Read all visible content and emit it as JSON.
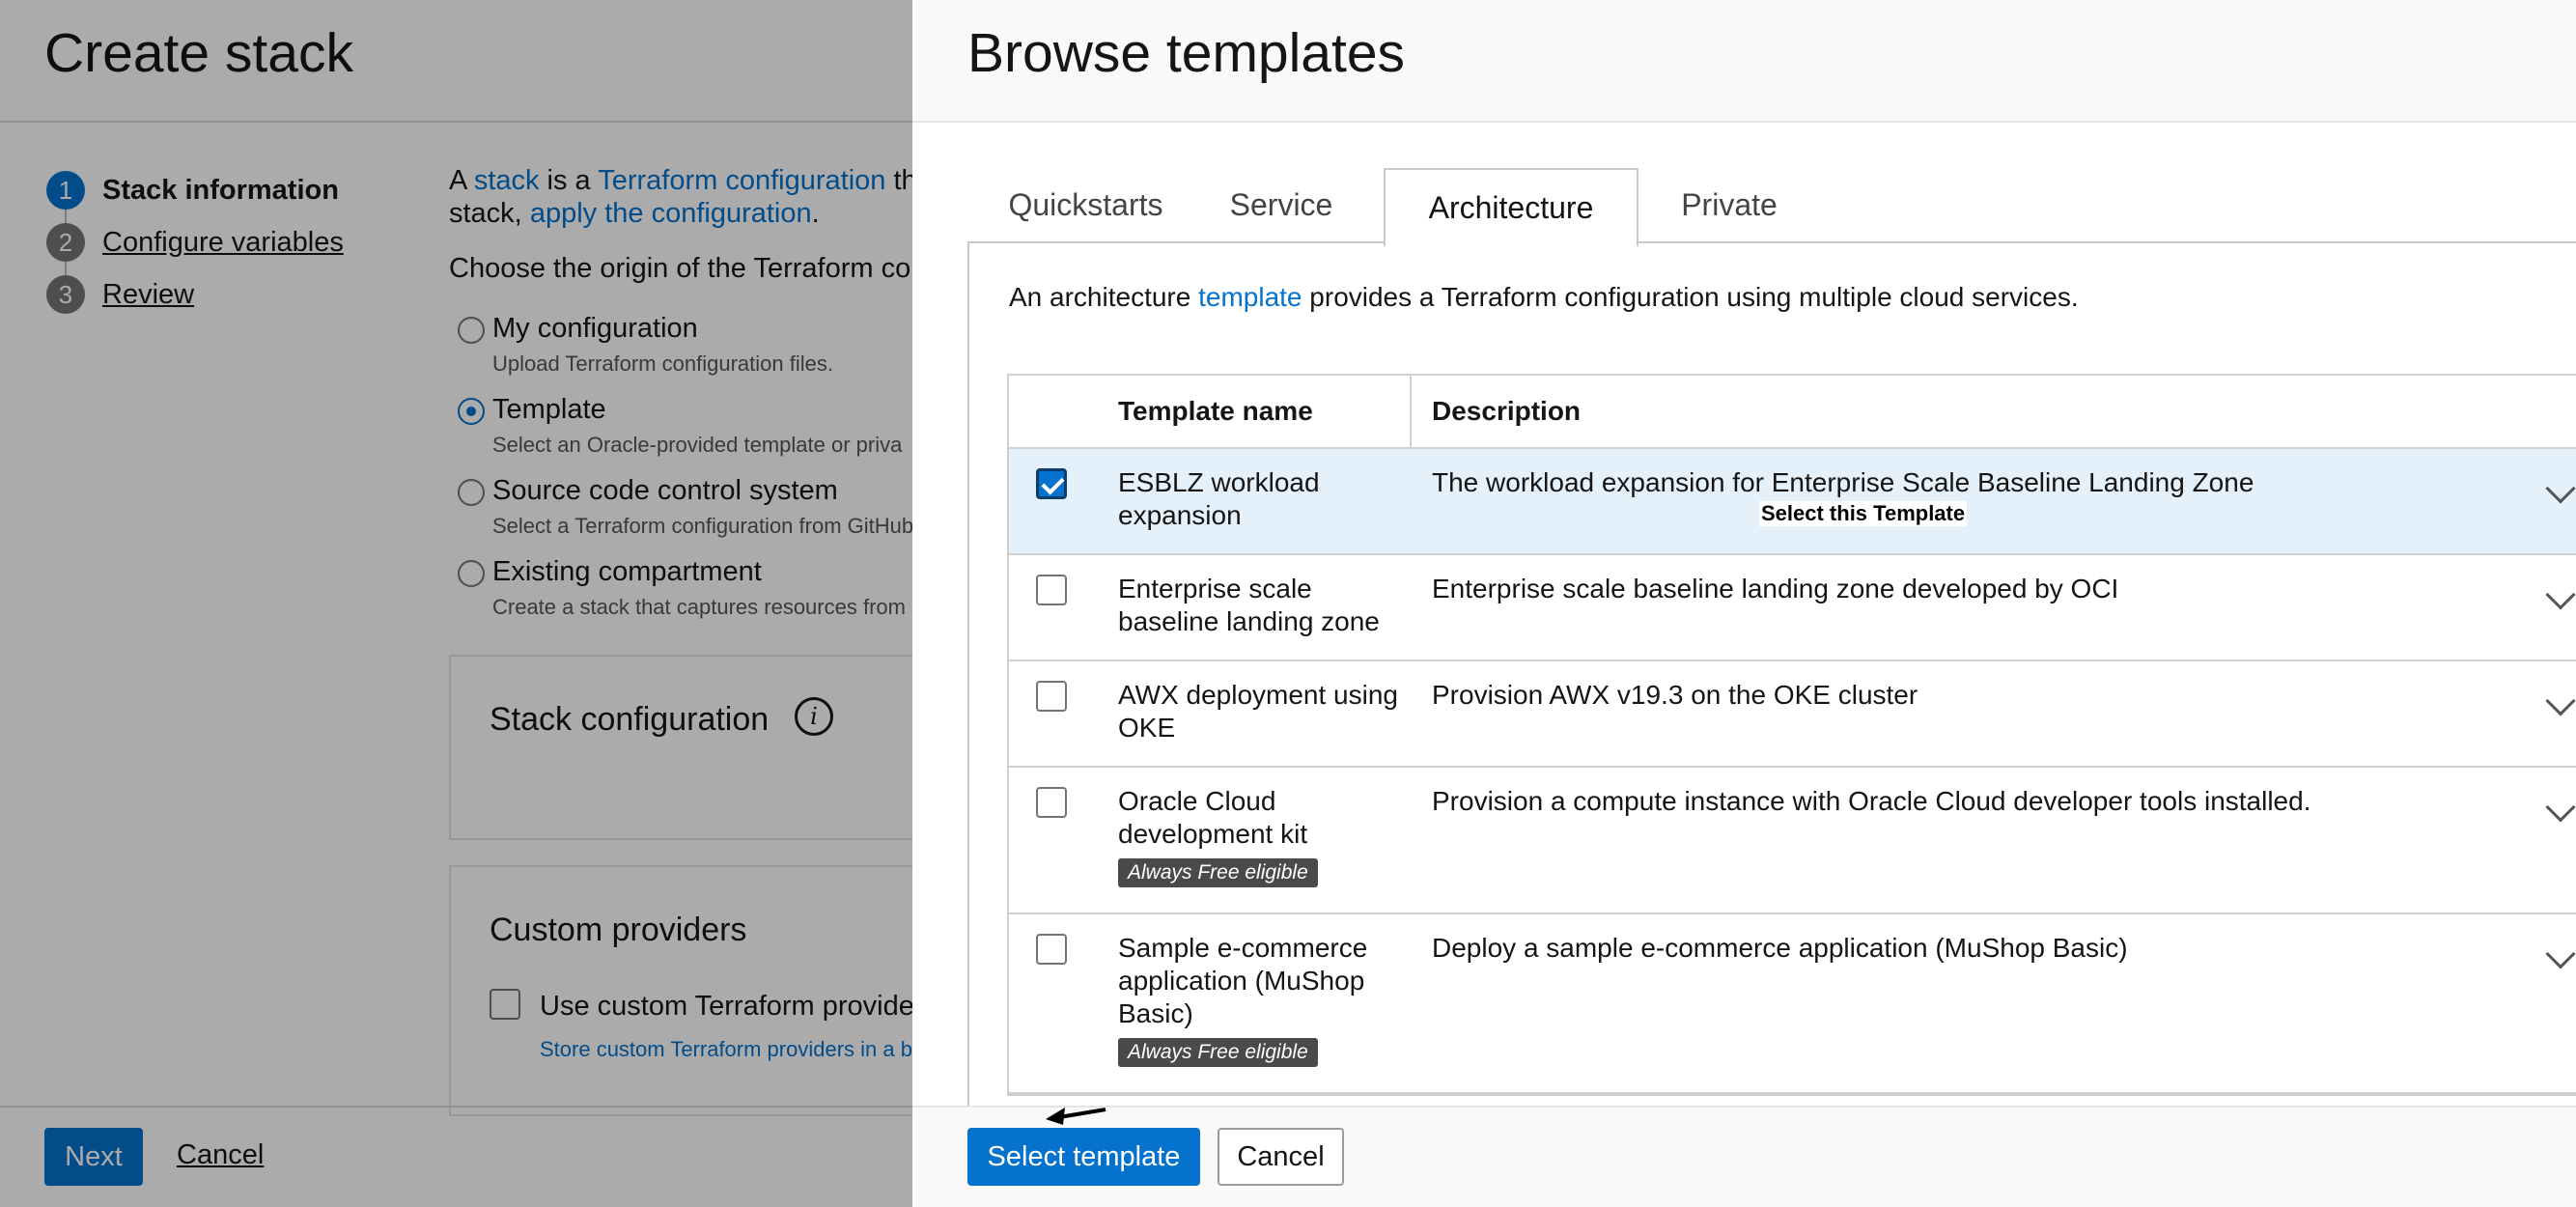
{
  "create_stack": {
    "title": "Create stack",
    "steps": [
      {
        "num": "1",
        "label": "Stack information"
      },
      {
        "num": "2",
        "label": "Configure variables"
      },
      {
        "num": "3",
        "label": "Review"
      }
    ],
    "intro": {
      "p1": "A ",
      "stack_link": "stack",
      "p2": " is a ",
      "terraform_link": "Terraform configuration",
      "p3": " tha",
      "p4": "stack, ",
      "apply_link": "apply the configuration",
      "p5": "."
    },
    "origin_question": "Choose the origin of the Terraform con",
    "origins": [
      {
        "label": "My configuration",
        "help": "Upload Terraform configuration files."
      },
      {
        "label": "Template",
        "help": "Select an Oracle-provided template or priva"
      },
      {
        "label": "Source code control system",
        "help": "Select a Terraform configuration from GitHub"
      },
      {
        "label": "Existing compartment",
        "help": "Create a stack that captures resources from"
      }
    ],
    "stack_config_title": "Stack configuration",
    "custom_providers_title": "Custom providers",
    "custom_providers_checkbox": "Use custom Terraform providers",
    "custom_providers_link": "Store custom Terraform providers in a b",
    "next_label": "Next",
    "cancel_label": "Cancel"
  },
  "browse": {
    "title": "Browse templates",
    "tabs": [
      "Quickstarts",
      "Service",
      "Architecture",
      "Private"
    ],
    "active_tab": "Architecture",
    "description_pre": "An architecture ",
    "description_link": "template",
    "description_post": " provides a Terraform configuration using multiple cloud services.",
    "columns": {
      "name": "Template name",
      "description": "Description"
    },
    "rows": [
      {
        "name": "ESBLZ workload expansion",
        "description": "The workload expansion for Enterprise Scale Baseline Landing Zone",
        "badge": "",
        "selected": true
      },
      {
        "name": "Enterprise scale baseline landing zone",
        "description": "Enterprise scale baseline landing zone developed by OCI",
        "badge": "",
        "selected": false
      },
      {
        "name": "AWX deployment using OKE",
        "description": "Provision AWX v19.3 on the OKE cluster",
        "badge": "",
        "selected": false
      },
      {
        "name": "Oracle Cloud development kit",
        "description": "Provision a compute instance with Oracle Cloud developer tools installed.",
        "badge": "Always Free eligible",
        "selected": false
      },
      {
        "name": "Sample e-commerce application (MuShop Basic)",
        "description": "Deploy a sample e-commerce application (MuShop Basic)",
        "badge": "Always Free eligible",
        "selected": false
      }
    ],
    "tooltip": "Select this Template",
    "select_label": "Select template",
    "cancel_label": "Cancel"
  },
  "colors": {
    "accent": "#0572ce",
    "selected_row": "#e4f0fa",
    "badge": "#4a4a4a"
  }
}
